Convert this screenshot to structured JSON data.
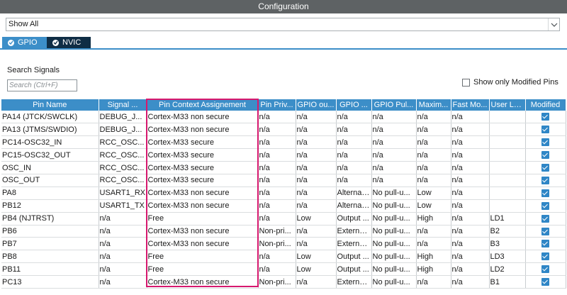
{
  "window": {
    "title": "Configuration"
  },
  "filter": {
    "selected": "Show All"
  },
  "tabs": [
    {
      "label": "GPIO",
      "active": true
    },
    {
      "label": "NVIC",
      "active": false
    }
  ],
  "search": {
    "label": "Search Signals",
    "placeholder": "Search (Ctrl+F)"
  },
  "modified_only": {
    "label": "Show only Modified Pins",
    "checked": false
  },
  "colors": {
    "header_bg": "#3c8ec8",
    "titlebar_bg": "#5e6264",
    "highlight": "#d6186e",
    "tab_inactive": "#0f2d45"
  },
  "table": {
    "columns": [
      "Pin Name",
      "Signal ...",
      "Pin Context Assignement",
      "Pin Priv...",
      "GPIO ou...",
      "GPIO ...",
      "GPIO Pul...",
      "Maxim...",
      "Fast Mo...",
      "User La...",
      "Modified"
    ],
    "rows": [
      [
        "PA14 (JTCK/SWCLK)",
        "DEBUG_J...",
        "Cortex-M33 non secure",
        "n/a",
        "n/a",
        "n/a",
        "n/a",
        "n/a",
        "n/a",
        "",
        true
      ],
      [
        "PA13 (JTMS/SWDIO)",
        "DEBUG_J...",
        "Cortex-M33 non secure",
        "n/a",
        "n/a",
        "n/a",
        "n/a",
        "n/a",
        "n/a",
        "",
        true
      ],
      [
        "PC14-OSC32_IN",
        "RCC_OSC...",
        "Cortex-M33 secure",
        "n/a",
        "n/a",
        "n/a",
        "n/a",
        "n/a",
        "n/a",
        "",
        true
      ],
      [
        "PC15-OSC32_OUT",
        "RCC_OSC...",
        "Cortex-M33 secure",
        "n/a",
        "n/a",
        "n/a",
        "n/a",
        "n/a",
        "n/a",
        "",
        true
      ],
      [
        "OSC_IN",
        "RCC_OSC...",
        "Cortex-M33 secure",
        "n/a",
        "n/a",
        "n/a",
        "n/a",
        "n/a",
        "n/a",
        "",
        true
      ],
      [
        "OSC_OUT",
        "RCC_OSC...",
        "Cortex-M33 secure",
        "n/a",
        "n/a",
        "n/a",
        "n/a",
        "n/a",
        "n/a",
        "",
        true
      ],
      [
        "PA8",
        "USART1_RX",
        "Cortex-M33 non secure",
        "n/a",
        "n/a",
        "Alternat...",
        "No pull-u...",
        "Low",
        "n/a",
        "",
        true
      ],
      [
        "PB12",
        "USART1_TX",
        "Cortex-M33 non secure",
        "n/a",
        "n/a",
        "Alternat...",
        "No pull-u...",
        "Low",
        "n/a",
        "",
        true
      ],
      [
        "PB4 (NJTRST)",
        "n/a",
        "Free",
        "n/a",
        "Low",
        "Output ...",
        "No pull-u...",
        "High",
        "n/a",
        "LD1",
        true
      ],
      [
        "PB6",
        "n/a",
        "Cortex-M33 non secure",
        "Non-pri...",
        "n/a",
        "Externa...",
        "No pull-u...",
        "n/a",
        "n/a",
        "B2",
        true
      ],
      [
        "PB7",
        "n/a",
        "Cortex-M33 non secure",
        "Non-pri...",
        "n/a",
        "Externa...",
        "No pull-u...",
        "n/a",
        "n/a",
        "B3",
        true
      ],
      [
        "PB8",
        "n/a",
        "Free",
        "n/a",
        "Low",
        "Output ...",
        "No pull-u...",
        "High",
        "n/a",
        "LD3",
        true
      ],
      [
        "PB11",
        "n/a",
        "Free",
        "n/a",
        "Low",
        "Output ...",
        "No pull-u...",
        "High",
        "n/a",
        "LD2",
        true
      ],
      [
        "PC13",
        "n/a",
        "Cortex-M33 non secure",
        "Non-pri...",
        "n/a",
        "Externa...",
        "No pull-u...",
        "n/a",
        "n/a",
        "B1",
        true
      ]
    ]
  }
}
